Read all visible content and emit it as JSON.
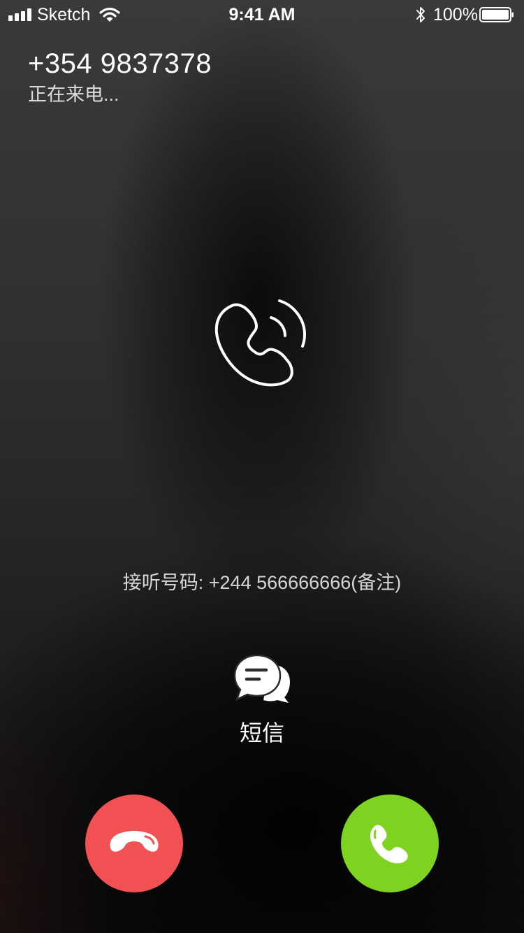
{
  "status_bar": {
    "carrier": "Sketch",
    "time": "9:41 AM",
    "battery_percent": "100%",
    "battery_level": 1.0,
    "signal_bars": 4,
    "icons": [
      "signal-icon",
      "wifi-icon",
      "bluetooth-icon",
      "battery-icon"
    ]
  },
  "call": {
    "caller_number": "+354 9837378",
    "status": "正在来电...",
    "receiving_line": "接听号码: +244 566666666(备注)"
  },
  "actions": {
    "sms_label": "短信",
    "sms_icon": "message-bubbles-icon",
    "decline_icon": "hang-up-icon",
    "accept_icon": "phone-icon",
    "ringing_icon": "phone-ringing-icon"
  },
  "colors": {
    "decline": "#f15152",
    "accept": "#7ed321",
    "text": "#ffffff"
  }
}
